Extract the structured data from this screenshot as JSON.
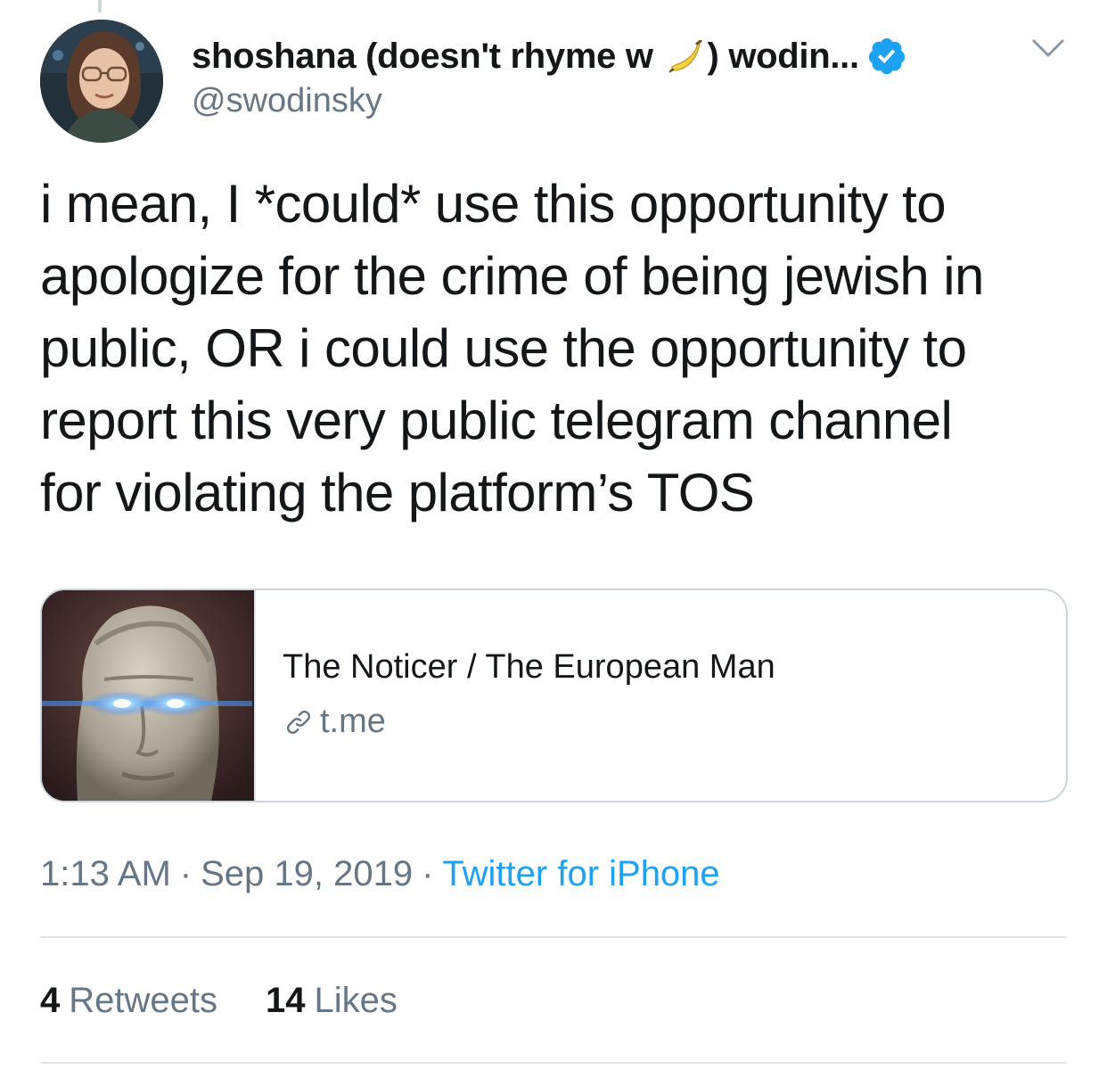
{
  "tweet": {
    "author": {
      "name_before_emoji": "shoshana (doesn't rhyme w ",
      "emoji": "banana-emoji",
      "name_after_emoji": ") wodin...",
      "handle": "@swodinsky",
      "verified": true
    },
    "text": "i mean, I *could* use this opportunity to\napologize for the crime of being jewish in\npublic, OR i could use the opportunity to\nreport this very public telegram channel\nfor violating the platform’s TOS",
    "link_card": {
      "title": "The Noticer / The European Man",
      "domain": "t.me"
    },
    "meta": {
      "time": "1:13 AM",
      "separator": "·",
      "date": "Sep 19, 2019",
      "source": "Twitter for iPhone"
    },
    "stats": {
      "retweets_count": "4",
      "retweets_label": "Retweets",
      "likes_count": "14",
      "likes_label": "Likes"
    }
  },
  "icons": {
    "menu": "chevron-down-icon",
    "verified": "verified-badge-icon",
    "link": "link-icon"
  },
  "colors": {
    "text": "#14171a",
    "secondary": "#657786",
    "accent": "#1da1f2",
    "border": "#ccd6dd"
  }
}
